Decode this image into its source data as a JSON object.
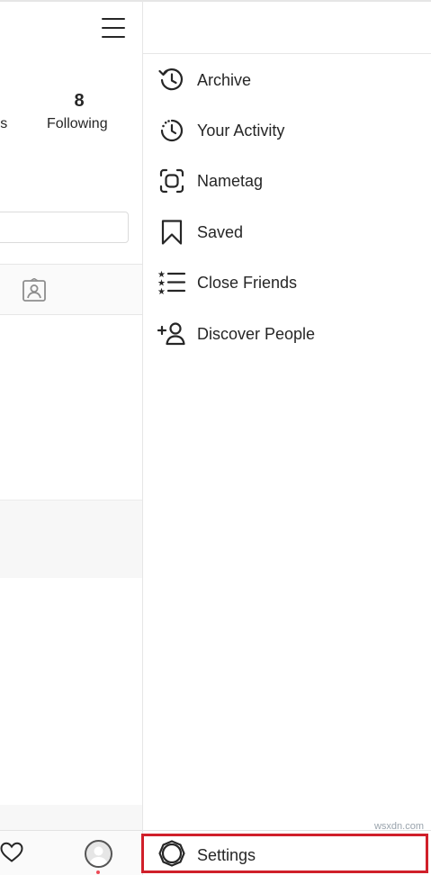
{
  "profile": {
    "followers_label": "ers",
    "following_count": "8",
    "following_label": "Following"
  },
  "drawer": {
    "items": [
      {
        "label": "Archive",
        "icon": "archive-icon"
      },
      {
        "label": "Your Activity",
        "icon": "activity-icon"
      },
      {
        "label": "Nametag",
        "icon": "nametag-icon"
      },
      {
        "label": "Saved",
        "icon": "bookmark-icon"
      },
      {
        "label": "Close Friends",
        "icon": "close-friends-icon"
      },
      {
        "label": "Discover People",
        "icon": "add-person-icon"
      }
    ],
    "settings_label": "Settings"
  },
  "bottom_nav": {
    "items": [
      "heart-icon",
      "profile-avatar"
    ]
  },
  "colors": {
    "highlight": "#d0202a",
    "notification_dot": "#ed4956",
    "text": "#262626"
  },
  "watermark": "wsxdn.com"
}
